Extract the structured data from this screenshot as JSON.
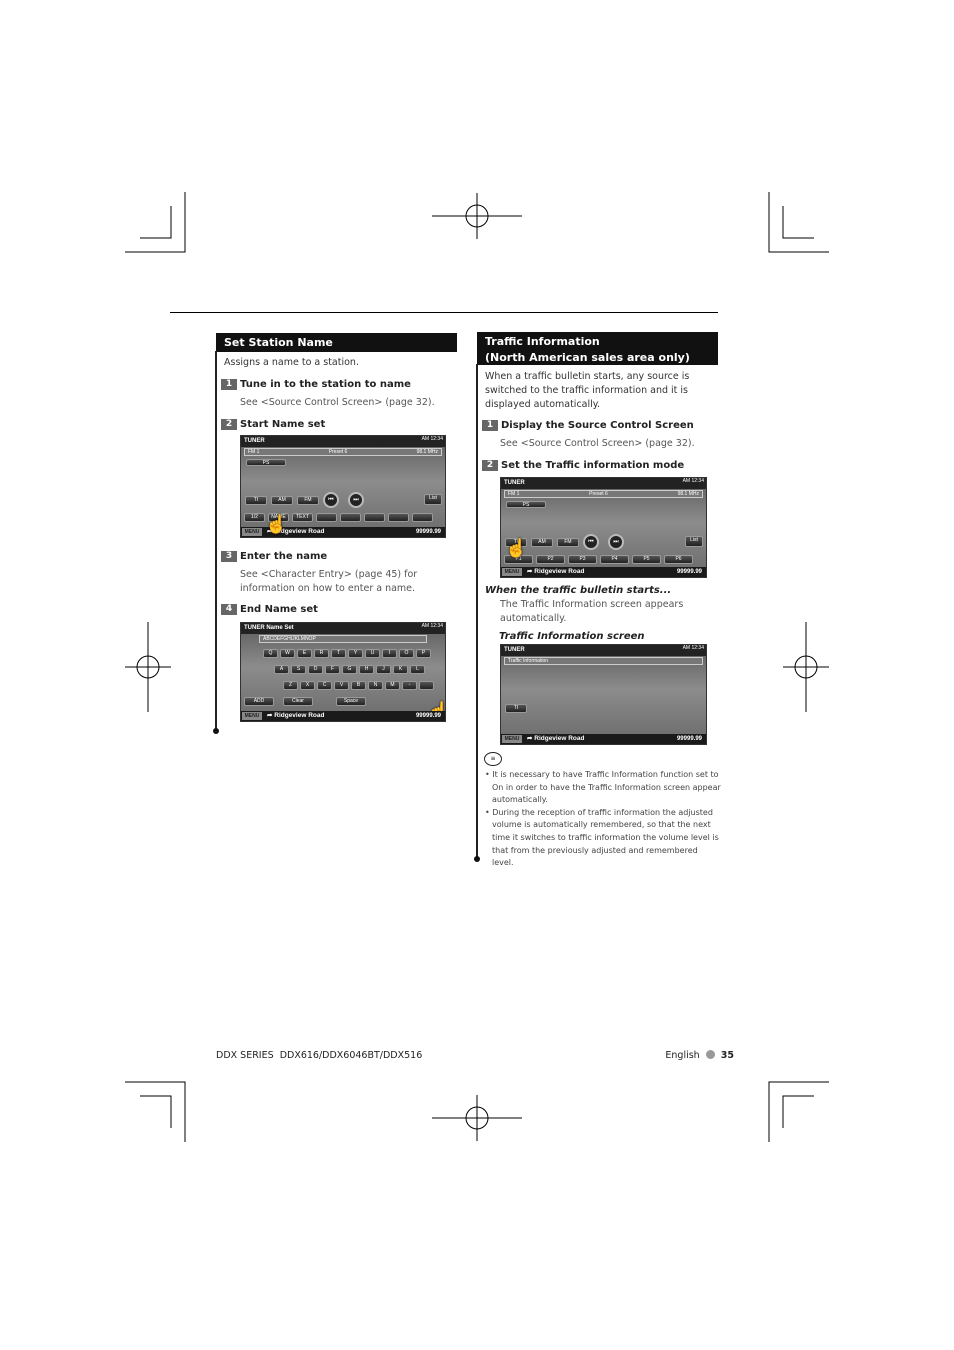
{
  "left": {
    "title": "Set Station Name",
    "intro": "Assigns a name to a station.",
    "steps": [
      {
        "num": "1",
        "title": "Tune in to the station to name",
        "body": "See <Source Control Screen> (page 32)."
      },
      {
        "num": "2",
        "title": "Start Name set"
      },
      {
        "num": "3",
        "title": "Enter the name",
        "body": "See <Character Entry> (page 45) for information on how to enter a name."
      },
      {
        "num": "4",
        "title": "End Name set"
      }
    ]
  },
  "right": {
    "title_line1": "Traffic Information",
    "title_line2": "(North American sales area only)",
    "intro": "When a traffic bulletin starts, any source is switched to the traffic information and it is displayed automatically.",
    "steps": [
      {
        "num": "1",
        "title": "Display the Source Control Screen",
        "body": "See <Source Control Screen> (page 32)."
      },
      {
        "num": "2",
        "title": "Set the Traffic information mode"
      }
    ],
    "when_title": "When the traffic bulletin starts...",
    "when_body": "The Traffic Information screen appears automatically.",
    "screen_label": "Traffic Information screen",
    "notes": [
      "It is necessary to have Traffic Information function set to On in order to have the Traffic Information screen appear automatically.",
      "During the reception of traffic information the adjusted volume is automatically remembered, so that the next time it switches to traffic information the volume level is that from the previously adjusted and remembered level."
    ]
  },
  "screens": {
    "tuner": {
      "title": "TUNER",
      "clock": "AM 12:34",
      "band": "FM 1",
      "preset": "Preset 6",
      "freq": "98.1 MHz",
      "ps": "PS",
      "buttons": [
        "TI",
        "AM",
        "FM"
      ],
      "list": "List",
      "menu": "MENU",
      "road": "Ridgeview Road",
      "odo": "99999.99"
    },
    "row_a": [
      "1/2",
      "NAME",
      "TEXT",
      "",
      "",
      "",
      "",
      ""
    ],
    "row_b": [
      "P1",
      "P2",
      "P3",
      "P4",
      "P5",
      "P6"
    ],
    "nameset": {
      "title": "TUNER Name Set",
      "input": "ABCDEFGHIJKLMNOP",
      "row1": [
        "Q",
        "W",
        "E",
        "R",
        "T",
        "Y",
        "U",
        "I",
        "O",
        "P"
      ],
      "row2": [
        "A",
        "S",
        "D",
        "F",
        "G",
        "H",
        "J",
        "K",
        "L"
      ],
      "row3": [
        "Z",
        "X",
        "C",
        "V",
        "B",
        "N",
        "M",
        "-",
        ""
      ],
      "add": "ADD",
      "clear": "Clear",
      "space": "Space"
    },
    "traffic": {
      "title": "TUNER",
      "bar": "Traffic Information",
      "ti": "TI"
    }
  },
  "footer": {
    "series": "DDX SERIES",
    "models": "DDX616/DDX6046BT/DDX516",
    "language": "English",
    "page": "35"
  }
}
